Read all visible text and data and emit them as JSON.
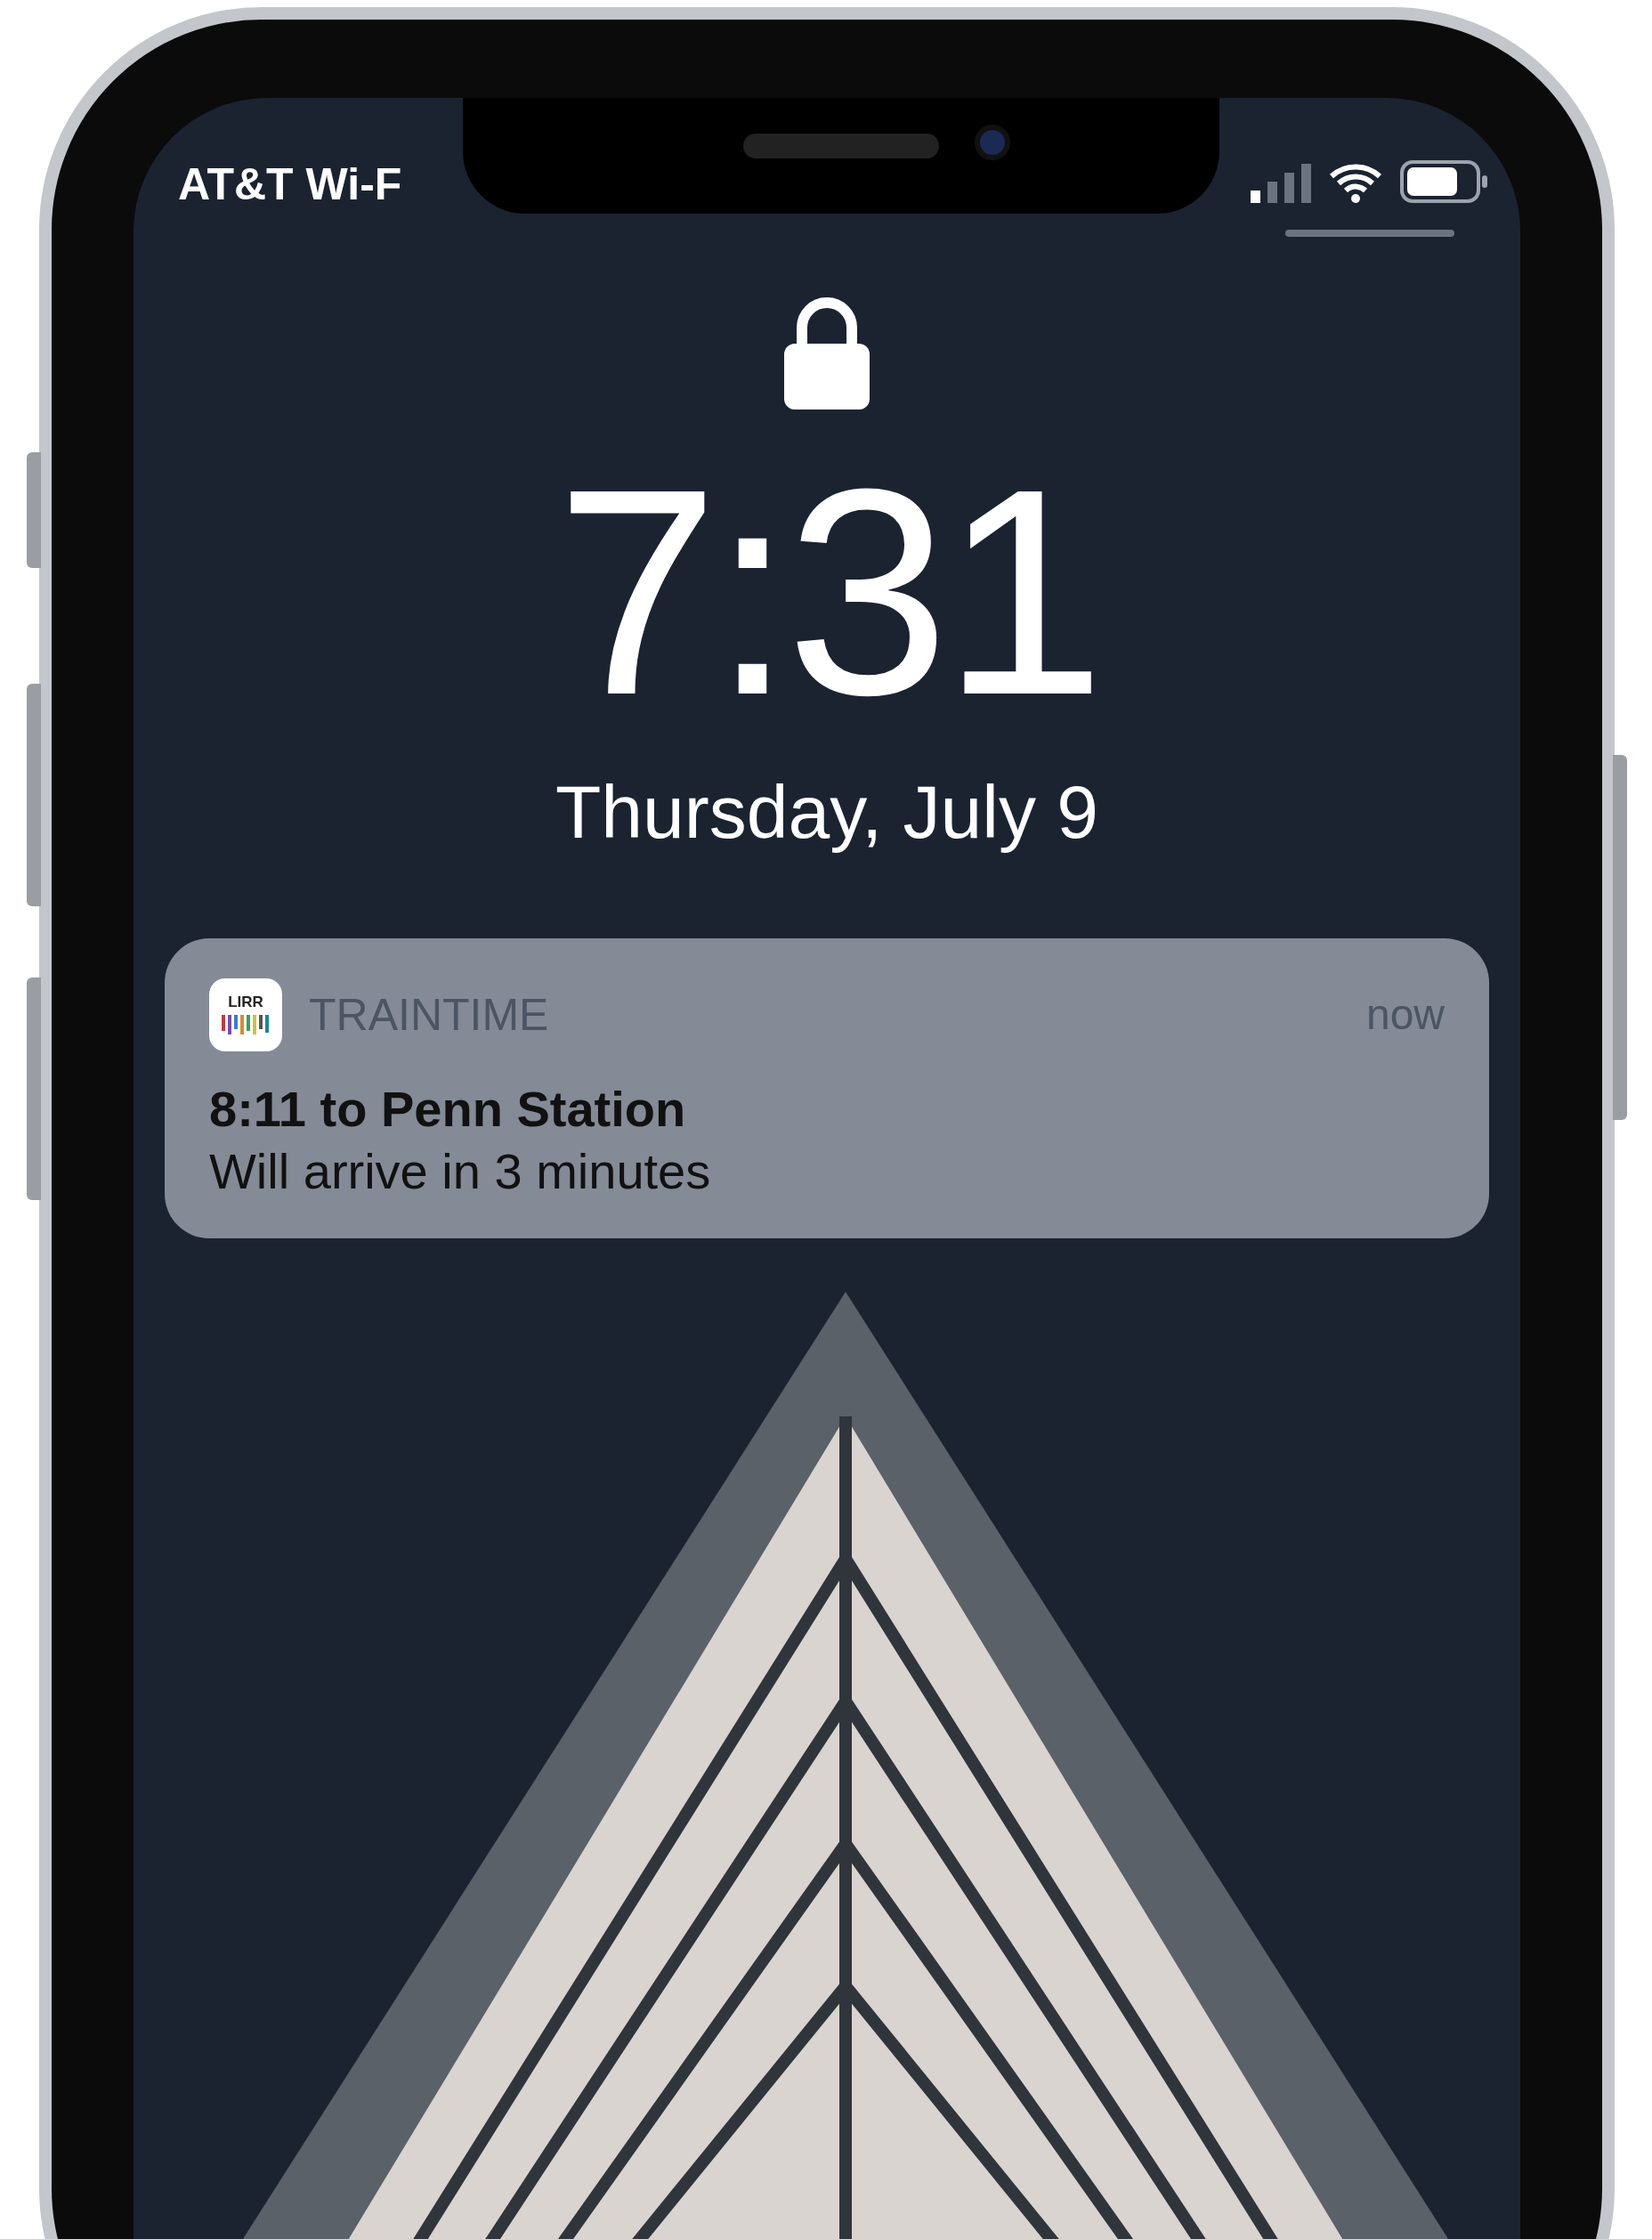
{
  "status_bar": {
    "carrier": "AT&T Wi-F"
  },
  "time": "7:31",
  "date": "Thursday, July 9",
  "notifications": [
    {
      "app_icon_label": "LIRR",
      "app": "TRAINTIME",
      "time": "now",
      "title": "8:11 to Penn Station",
      "body": "Will arrive in 3 minutes"
    }
  ]
}
